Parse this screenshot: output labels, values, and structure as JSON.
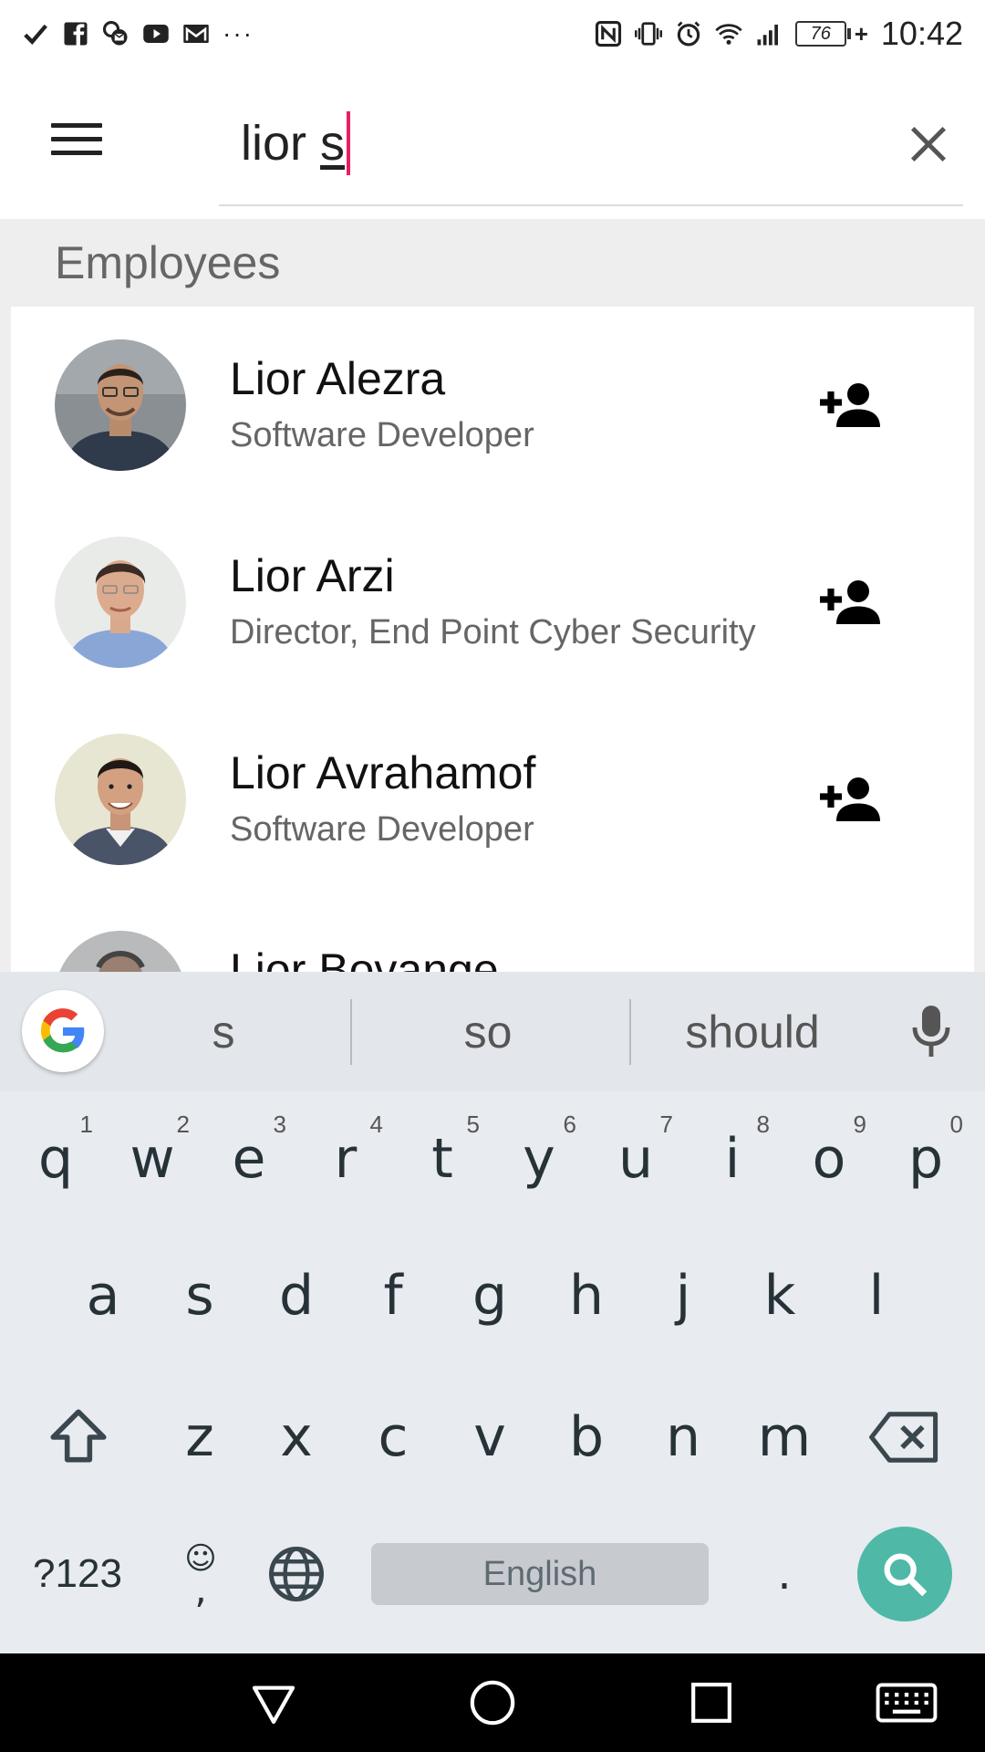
{
  "status_bar": {
    "left_icons": [
      "check-icon",
      "facebook-icon",
      "messenger-icon",
      "youtube-icon",
      "gmail-icon"
    ],
    "more": "···",
    "right_icons": [
      "nfc-icon",
      "vibrate-icon",
      "alarm-icon",
      "wifi-icon",
      "signal-icon"
    ],
    "battery": "76",
    "time": "10:42"
  },
  "search": {
    "query_prefix": "lior ",
    "query_word": "s"
  },
  "results": {
    "section_title": "Employees",
    "employees": [
      {
        "name": "Lior Alezra",
        "title": "Software Developer"
      },
      {
        "name": "Lior Arzi",
        "title": "Director, End Point Cyber Security"
      },
      {
        "name": "Lior Avrahamof",
        "title": "Software Developer"
      },
      {
        "name": "Lior Bovange",
        "title": ""
      }
    ]
  },
  "keyboard": {
    "suggestions": [
      "s",
      "so",
      "should"
    ],
    "row1": [
      {
        "key": "q",
        "hint": "1"
      },
      {
        "key": "w",
        "hint": "2"
      },
      {
        "key": "e",
        "hint": "3"
      },
      {
        "key": "r",
        "hint": "4"
      },
      {
        "key": "t",
        "hint": "5"
      },
      {
        "key": "y",
        "hint": "6"
      },
      {
        "key": "u",
        "hint": "7"
      },
      {
        "key": "i",
        "hint": "8"
      },
      {
        "key": "o",
        "hint": "9"
      },
      {
        "key": "p",
        "hint": "0"
      }
    ],
    "row2": [
      "a",
      "s",
      "d",
      "f",
      "g",
      "h",
      "j",
      "k",
      "l"
    ],
    "row3": [
      "z",
      "x",
      "c",
      "v",
      "b",
      "n",
      "m"
    ],
    "symbols_label": "?123",
    "emoji_label": "☺",
    "comma_label": ",",
    "space_label": "English",
    "period_label": "."
  },
  "colors": {
    "caret": "#e91e63",
    "search_key": "#4fb8a7",
    "keyboard_bg": "#e8ebef"
  }
}
